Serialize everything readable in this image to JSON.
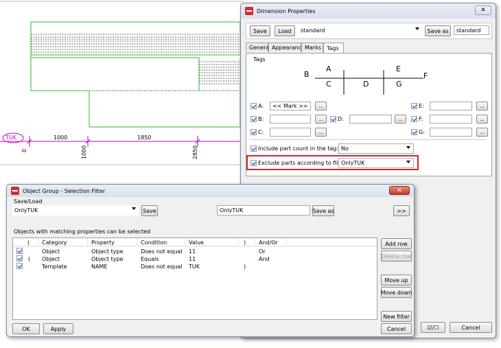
{
  "drawing": {
    "tag_label": "TUK",
    "dim_1000": "1000",
    "dim_1850": "1850",
    "ord_0": "0",
    "ord_1000": "1000",
    "ord_2850": "2850",
    "colors": {
      "magenta": "#c800c8",
      "green": "#2db82d"
    }
  },
  "dimension_dialog": {
    "title": "Dimension Properties",
    "save_label": "Save",
    "load_label": "Load",
    "preset_value": "standard",
    "save_as_label": "Save as",
    "save_as_name": "standard",
    "tabs": [
      "General",
      "Appearance",
      "Marks",
      "Tags"
    ],
    "group_title": "Tags",
    "diagram": {
      "A": "A",
      "B": "B",
      "C": "C",
      "D": "D",
      "E": "E",
      "F": "F",
      "G": "G"
    },
    "tag_rows": {
      "a_label": "A:",
      "a_value": "<< Mark >>",
      "b_label": "B:",
      "c_label": "C:",
      "d_label": "D:",
      "e_label": "E:",
      "f_label": "F:",
      "g_label": "G:",
      "ellipsis": "..."
    },
    "include_part_count_label": "Include part count in the tag:",
    "include_part_count_value": "No",
    "exclude_parts_label": "Exclude parts according to filter:",
    "exclude_parts_value": "OnlyTUK",
    "cancel_label": "Cancel",
    "toggle_glyph": "☑/☐"
  },
  "filter_dialog": {
    "title": "Object Group - Selection Filter",
    "saveload_label": "Save/Load",
    "preset_value": "OnlyTUK",
    "save_label": "Save",
    "name_value": "OnlyTUK",
    "save_as_label": "Save as",
    "more_label": ">>",
    "info_text": "Objects with matching properties can be selected",
    "columns": [
      "(",
      "Category",
      "Property",
      "Condition",
      "Value",
      ")",
      "And/Or"
    ],
    "rows": [
      {
        "open": "",
        "category": "Object",
        "property": "Object type",
        "condition": "Does not equal",
        "value": "11",
        "close": "",
        "andor": "Or"
      },
      {
        "open": "(",
        "category": "Object",
        "property": "Object type",
        "condition": "Equals",
        "value": "11",
        "close": "",
        "andor": "And"
      },
      {
        "open": "",
        "category": "Template",
        "property": "NAME",
        "condition": "Does not equal",
        "value": "TUK",
        "close": ")",
        "andor": ""
      }
    ],
    "add_row_label": "Add row",
    "delete_row_label": "Delete row",
    "move_up_label": "Move up",
    "move_down_label": "Move down",
    "new_filter_label": "New filter",
    "ok_label": "OK",
    "apply_label": "Apply",
    "cancel_label": "Cancel"
  }
}
